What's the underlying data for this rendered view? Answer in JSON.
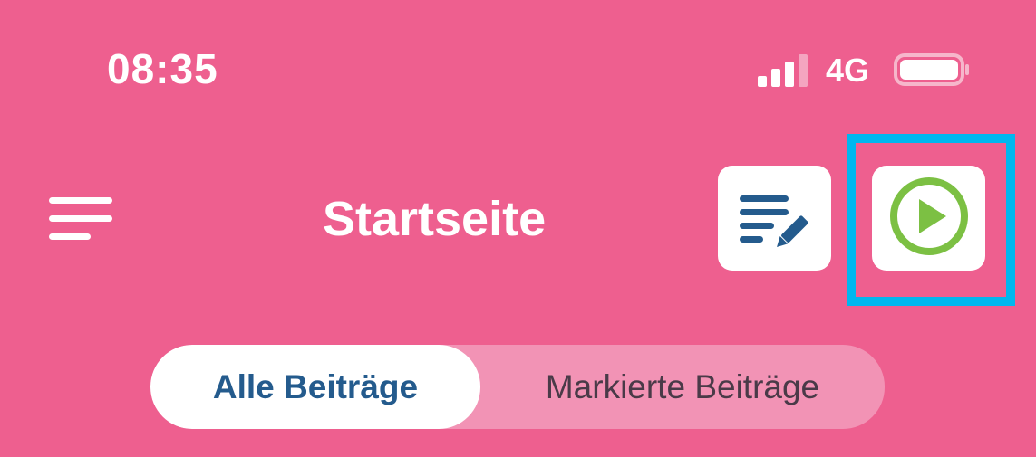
{
  "status_bar": {
    "time": "08:35",
    "network": "4G",
    "signal_bars_filled": 3,
    "signal_bars_total": 4
  },
  "header": {
    "title": "Startseite",
    "menu_icon": "menu-icon",
    "edit_icon": "list-edit-icon",
    "play_icon": "play-circle-icon"
  },
  "tabs": {
    "active": "Alle Beiträge",
    "inactive": "Markierte Beiträge"
  },
  "colors": {
    "background": "#ee5f8f",
    "accent_blue": "#245b8d",
    "play_green": "#7cc043",
    "highlight": "#00b7ef"
  }
}
